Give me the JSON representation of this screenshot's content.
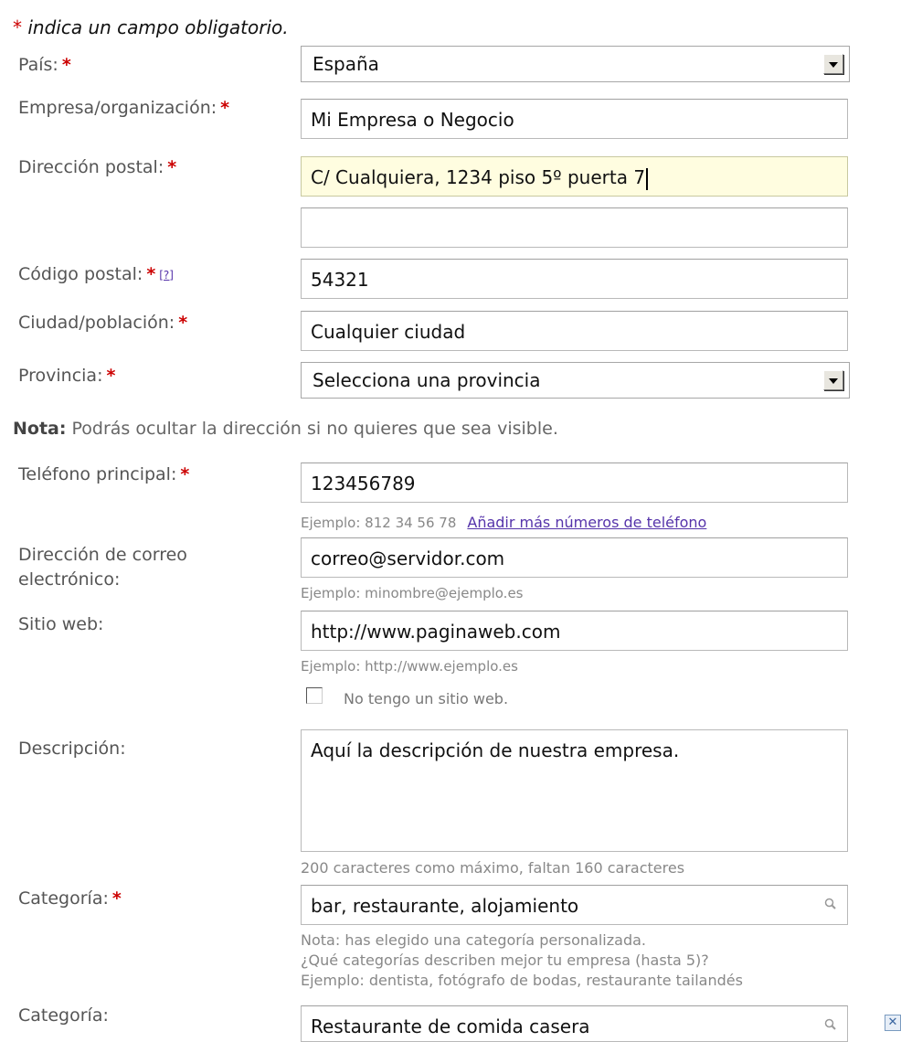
{
  "required_note": {
    "star": "*",
    "text": "indica un campo obligatorio."
  },
  "country": {
    "label": "País:",
    "required": "*",
    "value": "España"
  },
  "company": {
    "label": "Empresa/organización:",
    "required": "*",
    "value": "Mi Empresa o Negocio"
  },
  "address": {
    "label": "Dirección postal:",
    "required": "*",
    "line1": "C/ Cualquiera, 1234 piso 5º puerta 7",
    "line2": ""
  },
  "postal_code": {
    "label": "Código postal:",
    "required": "*",
    "help": "[?]",
    "value": "54321"
  },
  "city": {
    "label": "Ciudad/población:",
    "required": "*",
    "value": "Cualquier ciudad"
  },
  "province": {
    "label": "Provincia:",
    "required": "*",
    "value": "Selecciona una provincia"
  },
  "address_note": {
    "bold": "Nota:",
    "text": "Podrás ocultar la dirección si no quieres que sea visible."
  },
  "phone": {
    "label": "Teléfono principal:",
    "required": "*",
    "value": "123456789",
    "example": "Ejemplo: 812 34 56 78",
    "add_more_link": "Añadir más números de teléfono"
  },
  "email": {
    "label_line1": "Dirección de correo",
    "label_line2": "electrónico:",
    "value": "correo@servidor.com",
    "example": "Ejemplo: minombre@ejemplo.es"
  },
  "website": {
    "label": "Sitio web:",
    "value": "http://www.paginaweb.com",
    "example": "Ejemplo: http://www.ejemplo.es",
    "no_website_label": "No tengo un sitio web."
  },
  "description": {
    "label": "Descripción:",
    "value": "Aquí la descripción  de nuestra empresa.",
    "counter": "200 caracteres como máximo, faltan 160 caracteres"
  },
  "category1": {
    "label": "Categoría:",
    "required": "*",
    "value": "bar, restaurante, alojamiento",
    "note1": "Nota: has elegido una categoría personalizada.",
    "note2": "¿Qué categorías describen mejor tu empresa (hasta 5)?",
    "note3": "Ejemplo: dentista, fotógrafo de bodas, restaurante tailandés"
  },
  "category2": {
    "label": "Categoría:",
    "value": "Restaurante de comida casera"
  },
  "icons": {
    "search": "search-icon",
    "remove": "close-icon",
    "dropdown": "chevron-down-icon"
  }
}
